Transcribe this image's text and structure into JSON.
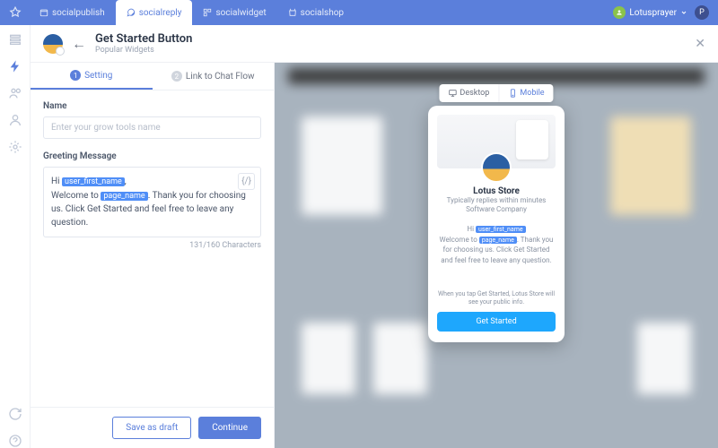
{
  "topnav": {
    "tabs": [
      {
        "label": "socialpublish"
      },
      {
        "label": "socialreply"
      },
      {
        "label": "socialwidget"
      },
      {
        "label": "socialshop"
      }
    ],
    "username": "Lotusprayer",
    "user_badge": "P"
  },
  "header": {
    "title": "Get Started Button",
    "subtitle": "Popular Widgets"
  },
  "subtabs": {
    "setting": {
      "num": "1",
      "label": "Setting"
    },
    "link": {
      "num": "2",
      "label": "Link to Chat Flow"
    }
  },
  "form": {
    "name_label": "Name",
    "name_placeholder": "Enter your grow tools name",
    "greeting_label": "Greeting Message",
    "greeting": {
      "pre1": "Hi ",
      "var1": "user_first_name",
      "mid1": ",",
      "line2a": "Welcome to ",
      "var2": "page_name",
      "line2b": ". Thank you for choosing us. Click Get Started and feel free to leave any question."
    },
    "insert_var_label": "{/}",
    "char_count": "131/160 Characters"
  },
  "footer": {
    "draft": "Save as draft",
    "continue": "Continue"
  },
  "preview": {
    "desktop": "Desktop",
    "mobile": "Mobile",
    "store_name": "Lotus Store",
    "reply_line": "Typically replies within minutes",
    "company_line": "Software Company",
    "msg": {
      "pre1": "Hi ",
      "var1": "user_first_name",
      "line2a": "Welcome to ",
      "var2": "page_name",
      "line2b": ". Thank you for choosing us. Click Get Started and feel free to leave any question."
    },
    "info": "When you tap Get Started, Lotus Store will see your public info.",
    "cta": "Get Started"
  }
}
